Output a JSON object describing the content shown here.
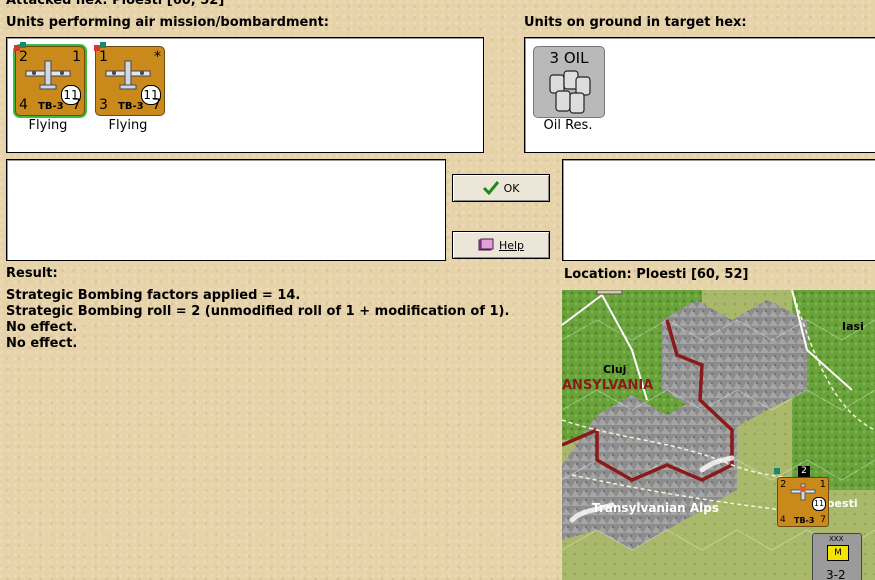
{
  "header": {
    "attacked_hex": "Attacked hex: Ploesti [60, 52]"
  },
  "air_units": {
    "label": "Units performing air mission/bombardment:",
    "items": [
      {
        "top_left": "2",
        "top_right": "1",
        "bottom_left": "4",
        "bottom_right": "7",
        "circle": "11",
        "code": "TB-3",
        "status": "Flying"
      },
      {
        "top_left": "1",
        "top_right": "*",
        "bottom_left": "3",
        "bottom_right": "7",
        "circle": "11",
        "code": "TB-3",
        "status": "Flying"
      }
    ]
  },
  "ground_units": {
    "label": "Units on ground in target hex:",
    "items": [
      {
        "value": "3 OIL",
        "name": "Oil Res."
      }
    ]
  },
  "buttons": {
    "ok": "OK",
    "help": "Help"
  },
  "result": {
    "label": "Result:",
    "lines": [
      "Strategic Bombing factors applied = 14.",
      "Strategic Bombing roll = 2 (unmodified roll of 1 + modification of 1).",
      "No effect.",
      "No effect."
    ]
  },
  "location": {
    "label": "Location: Ploesti [60, 52]"
  },
  "map": {
    "places": {
      "cluj": "Cluj",
      "transylvania": "ANSYLVANIA",
      "alps": "Transylvanian Alps",
      "iasi": "Iasi",
      "ploesti": "oesti"
    },
    "stack": {
      "count": "2",
      "a": "2",
      "b": "1",
      "c": "4",
      "d": "7",
      "circle": "11",
      "code": "TB-3"
    },
    "ground_counter": {
      "top": "XXX",
      "mid": "M",
      "value": "3-2"
    }
  },
  "colors": {
    "parchment": "#e7d3a9",
    "counter": "#c98a1b",
    "border_red": "#8b1a1a",
    "mountain": "#8c8c8c",
    "grass": "#6aa23c"
  }
}
